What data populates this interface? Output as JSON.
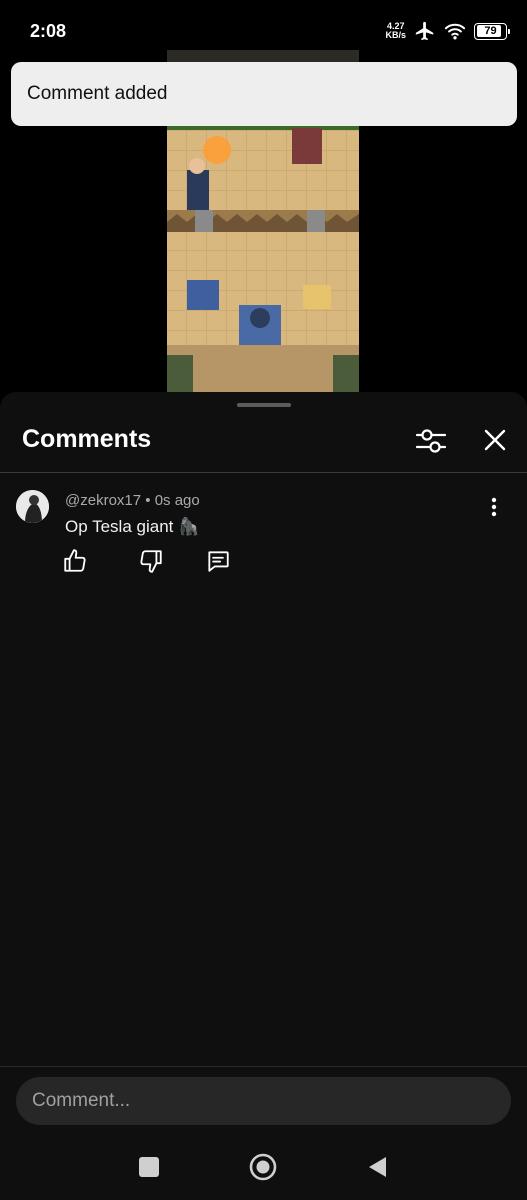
{
  "status_bar": {
    "time": "2:08",
    "net_speed_value": "4.27",
    "net_speed_unit": "KB/s",
    "battery_level": "79",
    "icons": [
      "airplane-icon",
      "wifi-icon",
      "battery-icon"
    ]
  },
  "toast": {
    "text": "Comment added"
  },
  "video": {
    "description_icon": "video-thumbnail"
  },
  "comments_sheet": {
    "title": "Comments",
    "icons": {
      "filter": "sliders-icon",
      "close": "close-icon"
    }
  },
  "comments": [
    {
      "author": "@zekrox17",
      "time": "0s ago",
      "separator": "•",
      "text": "Op Tesla giant 🦍",
      "actions": [
        "thumbs-up-icon",
        "thumbs-down-icon",
        "reply-icon"
      ]
    }
  ],
  "composer": {
    "placeholder": "Comment..."
  },
  "nav_bar": {
    "buttons": [
      "recents-square-icon",
      "home-circle-icon",
      "back-triangle-icon"
    ]
  },
  "colors": {
    "sheet_bg": "#0f0f0f",
    "toast_bg": "#eeeeee",
    "input_bg": "#272727"
  }
}
